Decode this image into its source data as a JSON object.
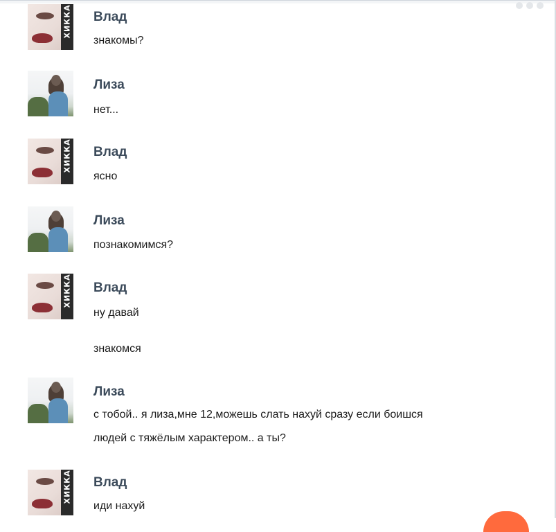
{
  "messages": [
    {
      "sender": "Влад",
      "avatar": "vlad-avatar",
      "lines": [
        "знакомы?"
      ]
    },
    {
      "sender": "Лиза",
      "avatar": "liza-avatar",
      "lines": [
        "нет..."
      ]
    },
    {
      "sender": "Влад",
      "avatar": "vlad-avatar",
      "lines": [
        "ясно"
      ]
    },
    {
      "sender": "Лиза",
      "avatar": "liza-avatar",
      "lines": [
        "познакомимся?"
      ]
    },
    {
      "sender": "Влад",
      "avatar": "vlad-avatar",
      "lines": [
        "ну давай",
        "знакомся"
      ]
    },
    {
      "sender": "Лиза",
      "avatar": "liza-avatar",
      "lines": [
        "с тобой.. я лиза,мне 12,можешь слать нахуй сразу если боишся",
        "людей с тяжёлым характером.. а ты?"
      ]
    },
    {
      "sender": "Влад",
      "avatar": "vlad-avatar",
      "lines": [
        "иди нахуй"
      ]
    }
  ],
  "avatar_badge_text": "ХИККА",
  "colors": {
    "sender_name": "#3b4a5a",
    "message_text": "#1a1a1a",
    "corner_badge": "#ff6a3d"
  }
}
